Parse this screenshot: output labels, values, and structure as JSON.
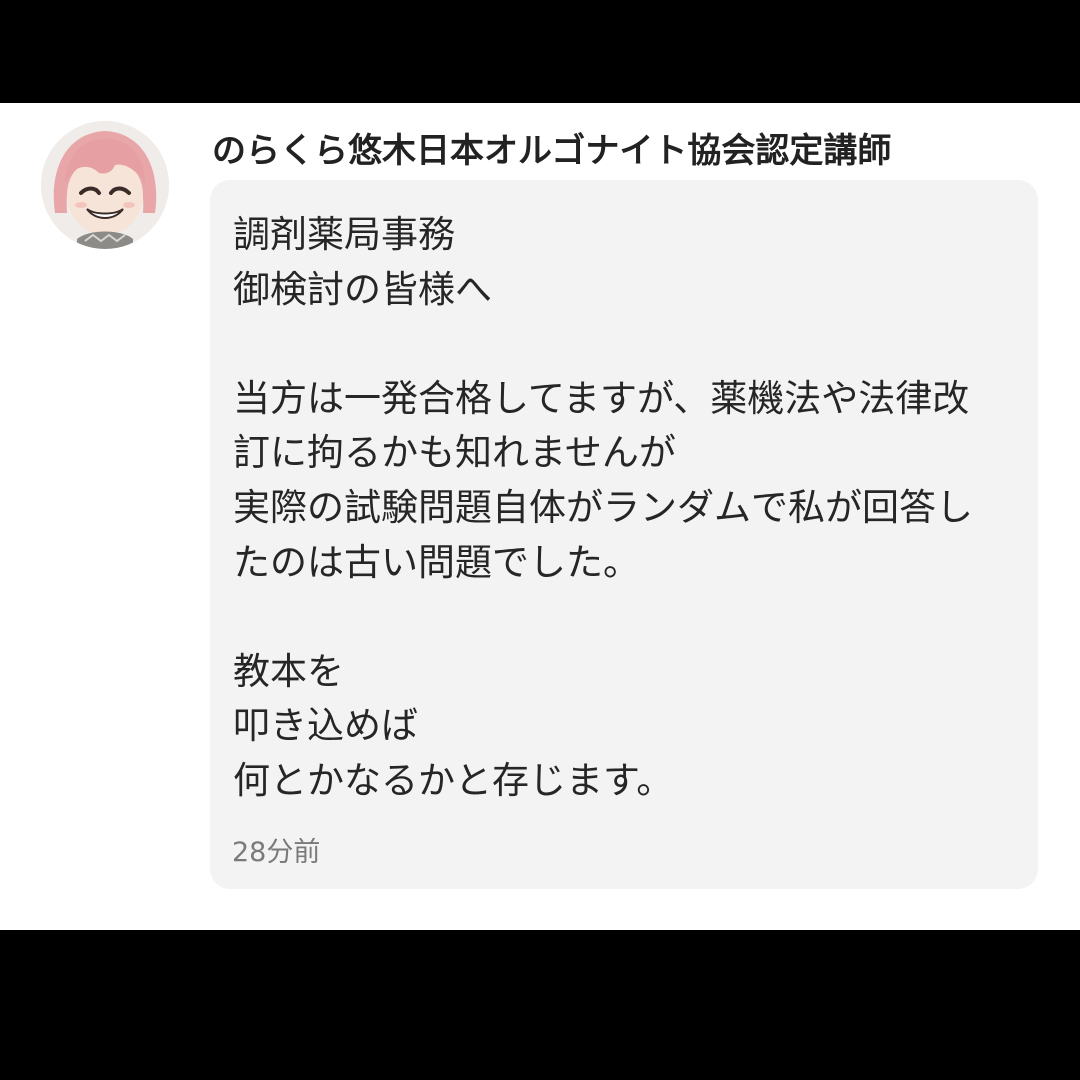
{
  "post": {
    "author_name": "のらくら悠木日本オルゴナイト協会認定講師",
    "avatar_icon": "anime-girl-avatar-icon",
    "message_lines": [
      "調剤薬局事務",
      "御検討の皆様へ",
      "",
      "当方は一発合格してますが、薬機法や法律改",
      "訂に拘るかも知れませんが",
      "実際の試験問題自体がランダムで私が回答し",
      "たのは古い問題でした。",
      "",
      "教本を",
      "叩き込めば",
      "何とかなるかと存じます。"
    ],
    "timestamp": "28分前"
  },
  "colors": {
    "letterbox": "#000000",
    "background": "#ffffff",
    "bubble": "#f3f3f3",
    "text": "#262626",
    "author_text": "#222222",
    "timestamp_text": "#7a7a7a"
  }
}
